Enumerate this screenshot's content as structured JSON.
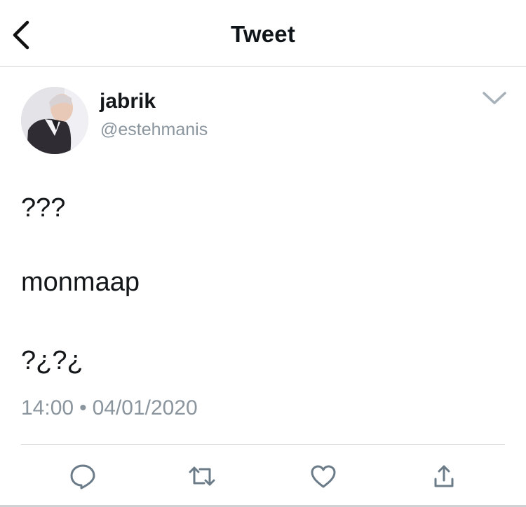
{
  "header": {
    "title": "Tweet",
    "back_icon": "chevron-left-icon"
  },
  "tweet": {
    "author_name": "jabrik",
    "author_handle": "@estehmanis",
    "lines": [
      "???",
      "monmaap",
      "?¿?¿"
    ],
    "time": "14:00",
    "separator": "•",
    "date": "04/01/2020"
  },
  "actions": {
    "icons": [
      "reply-icon",
      "retweet-icon",
      "like-icon",
      "share-icon"
    ]
  },
  "colors": {
    "text": "#14171a",
    "secondary": "#8a959e",
    "divider": "#d4d8db"
  }
}
